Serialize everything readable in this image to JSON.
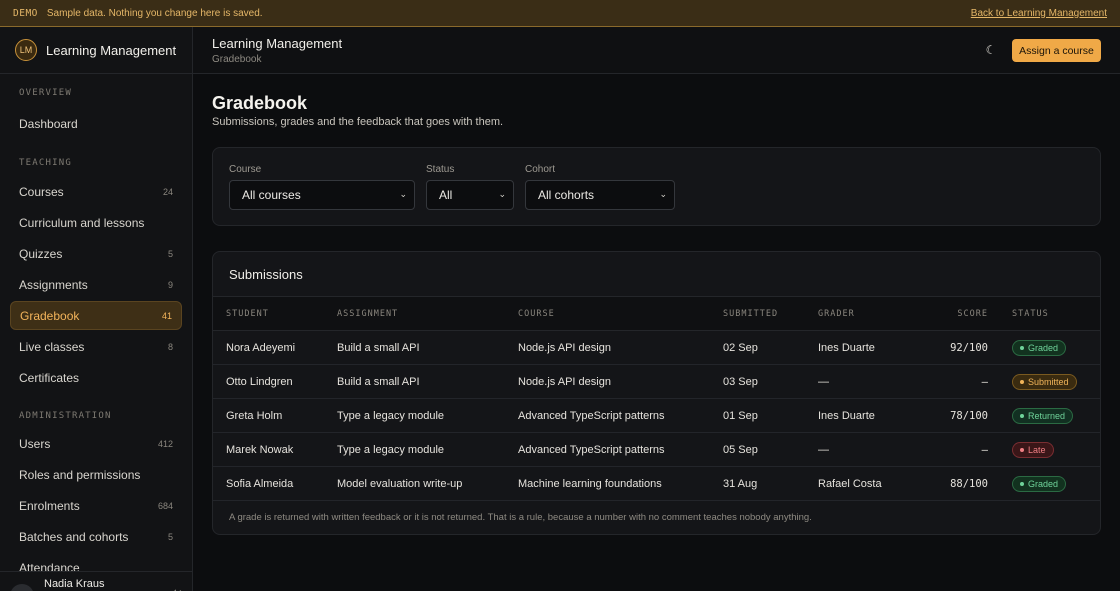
{
  "banner": {
    "tag": "DEMO",
    "message": "Sample data. Nothing you change here is saved.",
    "link": "Back to Learning Management"
  },
  "brand": {
    "initials": "LM",
    "name": "Learning Management"
  },
  "sidebar": {
    "sections": [
      {
        "label": "OVERVIEW",
        "items": [
          {
            "label": "Dashboard",
            "count": ""
          }
        ]
      },
      {
        "label": "TEACHING",
        "items": [
          {
            "label": "Courses",
            "count": "24"
          },
          {
            "label": "Curriculum and lessons",
            "count": ""
          },
          {
            "label": "Quizzes",
            "count": "5"
          },
          {
            "label": "Assignments",
            "count": "9"
          },
          {
            "label": "Gradebook",
            "count": "41"
          },
          {
            "label": "Live classes",
            "count": "8"
          },
          {
            "label": "Certificates",
            "count": ""
          }
        ]
      },
      {
        "label": "ADMINISTRATION",
        "items": [
          {
            "label": "Users",
            "count": "412"
          },
          {
            "label": "Roles and permissions",
            "count": ""
          },
          {
            "label": "Enrolments",
            "count": "684"
          },
          {
            "label": "Batches and cohorts",
            "count": "5"
          },
          {
            "label": "Attendance",
            "count": ""
          }
        ]
      }
    ],
    "user": {
      "initials": "NK",
      "name": "Nadia Kraus"
    }
  },
  "topbar": {
    "title": "Learning Management",
    "crumb": "Gradebook",
    "cta": "Assign a course"
  },
  "page": {
    "title": "Gradebook",
    "subtitle": "Submissions, grades and the feedback that goes with them."
  },
  "filters": {
    "course": {
      "label": "Course",
      "value": "All courses"
    },
    "status": {
      "label": "Status",
      "value": "All"
    },
    "cohort": {
      "label": "Cohort",
      "value": "All cohorts"
    }
  },
  "submissions": {
    "title": "Submissions",
    "columns": [
      "STUDENT",
      "ASSIGNMENT",
      "COURSE",
      "SUBMITTED",
      "GRADER",
      "SCORE",
      "STATUS"
    ],
    "rows": [
      {
        "student": "Nora Adeyemi",
        "assignment": "Build a small API",
        "course": "Node.js API design",
        "submitted": "02 Sep",
        "grader": "Ines Duarte",
        "score": "92/100",
        "status": "Graded",
        "tone": "graded"
      },
      {
        "student": "Otto Lindgren",
        "assignment": "Build a small API",
        "course": "Node.js API design",
        "submitted": "03 Sep",
        "grader": "—",
        "score": "–",
        "status": "Submitted",
        "tone": "submitted"
      },
      {
        "student": "Greta Holm",
        "assignment": "Type a legacy module",
        "course": "Advanced TypeScript patterns",
        "submitted": "01 Sep",
        "grader": "Ines Duarte",
        "score": "78/100",
        "status": "Returned",
        "tone": "returned"
      },
      {
        "student": "Marek Nowak",
        "assignment": "Type a legacy module",
        "course": "Advanced TypeScript patterns",
        "submitted": "05 Sep",
        "grader": "—",
        "score": "–",
        "status": "Late",
        "tone": "late"
      },
      {
        "student": "Sofia Almeida",
        "assignment": "Model evaluation write-up",
        "course": "Machine learning foundations",
        "submitted": "31 Aug",
        "grader": "Rafael Costa",
        "score": "88/100",
        "status": "Graded",
        "tone": "graded"
      }
    ],
    "footnote": "A grade is returned with written feedback or it is not returned. That is a rule, because a number with no comment teaches nobody anything."
  },
  "colors": {
    "accent": "#f0a947",
    "active_bg": "#3e2f16"
  }
}
